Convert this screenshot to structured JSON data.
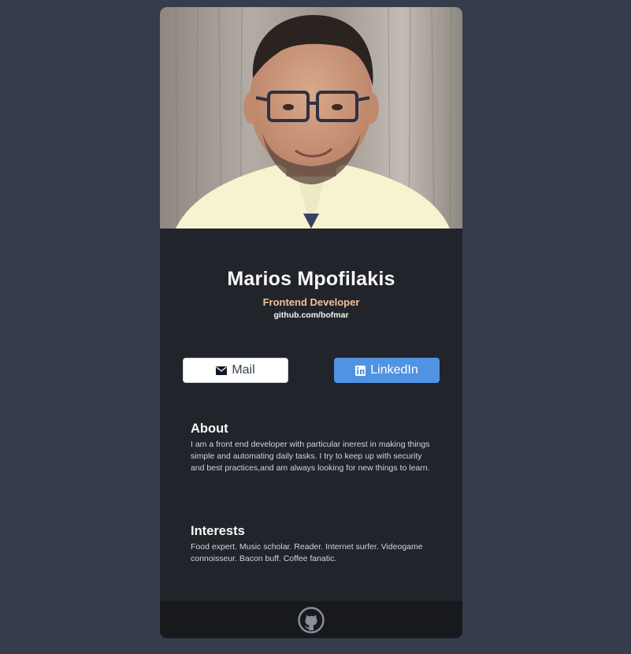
{
  "profile": {
    "name": "Marios Mpofilakis",
    "role": "Frontend Developer",
    "website": "github.com/bofmar",
    "photo_alt": "Profile photo"
  },
  "actions": {
    "mail_label": "Mail",
    "linkedin_label": "LinkedIn"
  },
  "about": {
    "title": "About",
    "text": "I am a front end developer with particular inerest in making things simple and automating daily tasks. I try to keep up with security and best practices,and am always looking for new things to learn."
  },
  "interests": {
    "title": "Interests",
    "text": "Food expert. Music scholar. Reader. Internet surfer. Videogame connoisseur. Bacon buff. Coffee fanatic."
  },
  "footer": {
    "icon": "github-icon"
  },
  "colors": {
    "page_background": "#353d4d",
    "card_background": "#22242b",
    "footer_background": "#18191d",
    "role_accent": "#f3bf99",
    "linkedin_blue": "#5093e2"
  }
}
